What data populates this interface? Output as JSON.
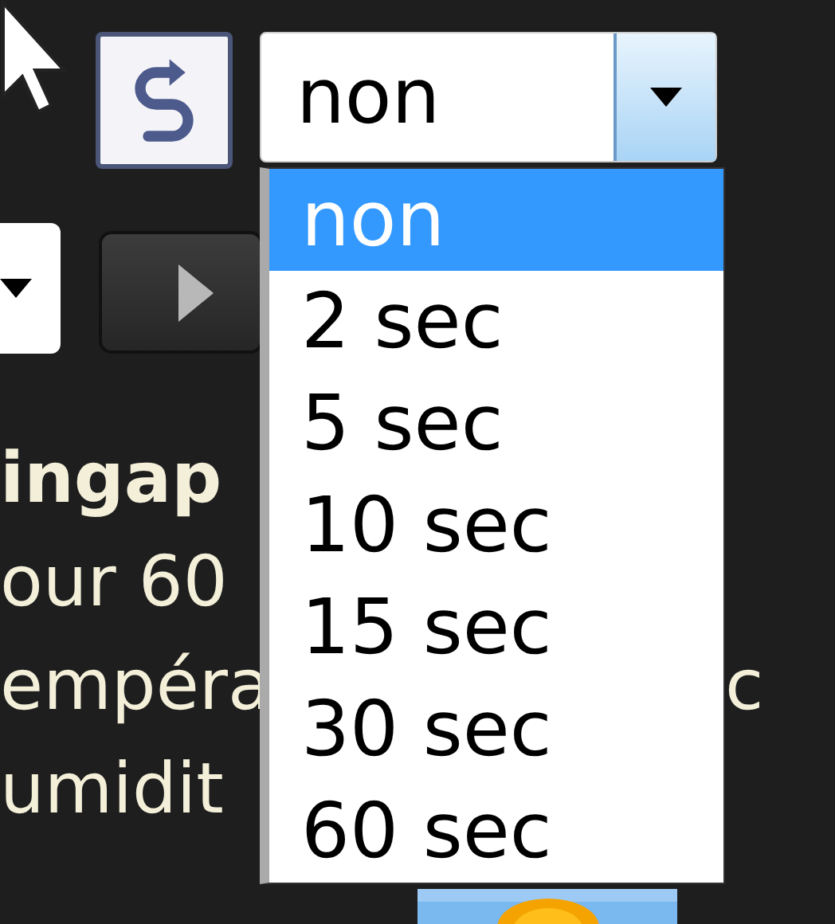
{
  "timer_select": {
    "value": "non",
    "expanded": true
  },
  "timer_options": [
    {
      "label": "non",
      "selected": true
    },
    {
      "label": "2 sec",
      "selected": false
    },
    {
      "label": "5 sec",
      "selected": false
    },
    {
      "label": "10 sec",
      "selected": false
    },
    {
      "label": "15 sec",
      "selected": false
    },
    {
      "label": "30 sec",
      "selected": false
    },
    {
      "label": "60 sec",
      "selected": false
    }
  ],
  "text_lines": [
    {
      "text": "ingap",
      "kind": "heading"
    },
    {
      "text": "our 60",
      "kind": "body"
    },
    {
      "text": "empéra",
      "kind": "body",
      "trailing": "c"
    },
    {
      "text": "umidit",
      "kind": "body"
    }
  ]
}
